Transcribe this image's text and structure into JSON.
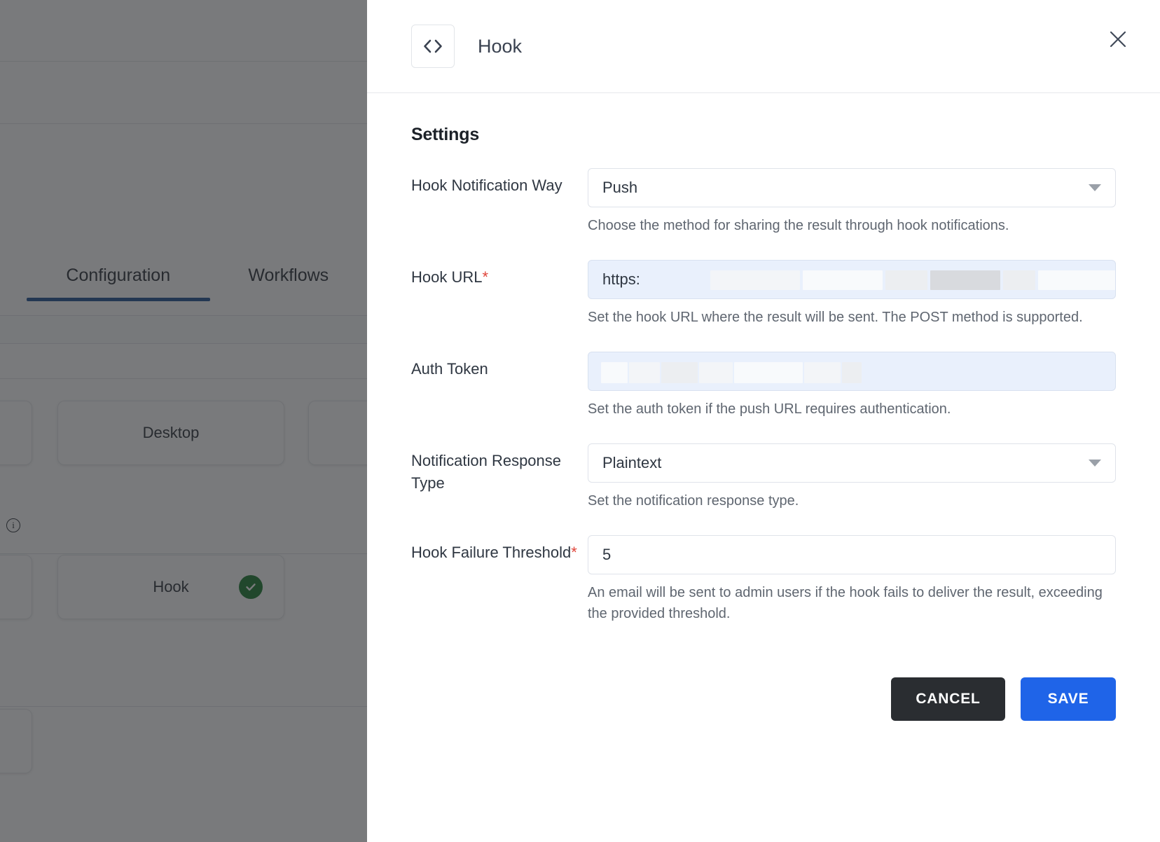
{
  "background": {
    "tabs": [
      {
        "label": "Configuration",
        "active": true
      },
      {
        "label": "Workflows",
        "active": false
      }
    ],
    "cards": [
      {
        "label": "Desktop",
        "checked": false
      },
      {
        "label": "Hook",
        "checked": true
      }
    ],
    "info_icon": "info-icon",
    "accent_tab_color": "#1d4f91",
    "check_color": "#1a7a2e",
    "scrim_color": "rgba(38,40,43,0.62)"
  },
  "modal": {
    "icon": "code-brackets-icon",
    "title": "Hook",
    "close_label": "close-icon",
    "section_title": "Settings",
    "fields": [
      {
        "name": "hook-notification-way",
        "label": "Hook Notification Way",
        "required": false,
        "control": "select",
        "value": "Push",
        "help": "Choose the method for sharing the result through hook notifications."
      },
      {
        "name": "hook-url",
        "label": "Hook URL",
        "required": true,
        "control": "masked-text",
        "value": "https:",
        "help": "Set the hook URL where the result will be sent. The POST method is supported."
      },
      {
        "name": "auth-token",
        "label": "Auth Token",
        "required": false,
        "control": "masked-text",
        "value": "",
        "help": "Set the auth token if the push URL requires authentication."
      },
      {
        "name": "notification-response-type",
        "label": "Notification Response Type",
        "required": false,
        "control": "select",
        "value": "Plaintext",
        "help": "Set the notification response type."
      },
      {
        "name": "hook-failure-threshold",
        "label": "Hook Failure Threshold",
        "required": true,
        "control": "number",
        "value": "5",
        "help": "An email will be sent to admin users if the hook fails to deliver the result, exceeding the provided threshold."
      }
    ],
    "buttons": {
      "cancel": "CANCEL",
      "save": "SAVE",
      "cancel_color": "#2a2d31",
      "save_color": "#1f64e8"
    }
  }
}
